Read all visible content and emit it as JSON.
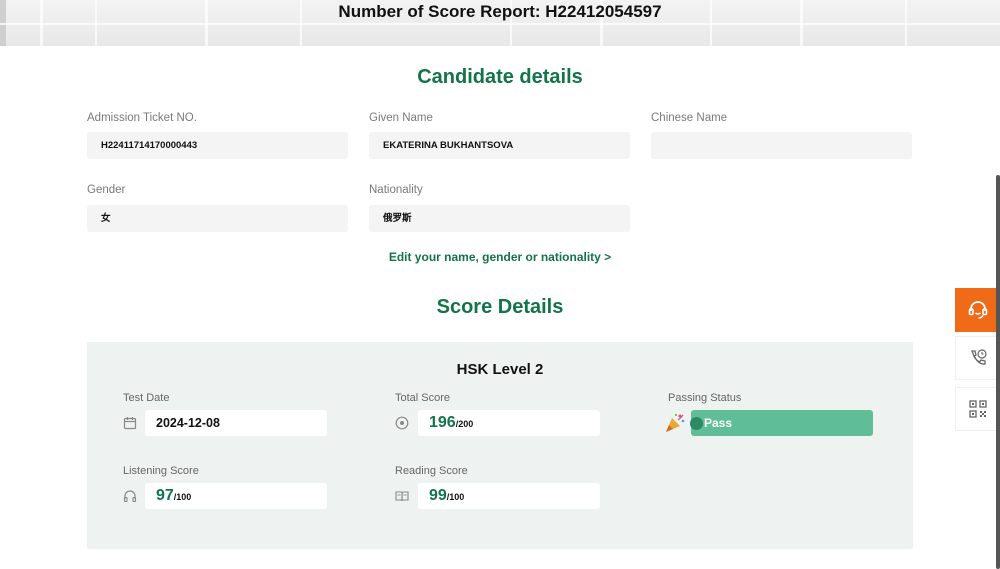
{
  "report": {
    "title": "Number of Score Report: H22412054597"
  },
  "candidate": {
    "section_title": "Candidate details",
    "admission_label": "Admission Ticket NO.",
    "admission_value": "H22411714170000443",
    "given_name_label": "Given Name",
    "given_name_value": "EKATERINA BUKHANTSOVA",
    "chinese_name_label": "Chinese Name",
    "chinese_name_value": "",
    "gender_label": "Gender",
    "gender_value": "女",
    "nationality_label": "Nationality",
    "nationality_value": "俄罗斯",
    "edit_link": "Edit your name, gender or nationality >"
  },
  "score": {
    "section_title": "Score Details",
    "level": "HSK Level 2",
    "test_date_label": "Test Date",
    "test_date_value": "2024-12-08",
    "total_label": "Total Score",
    "total_value": "196",
    "total_max": "/200",
    "passing_label": "Passing Status",
    "passing_value": "Pass",
    "listening_label": "Listening Score",
    "listening_value": "97",
    "listening_max": "/100",
    "reading_label": "Reading Score",
    "reading_value": "99",
    "reading_max": "/100"
  },
  "sidebar": {
    "buttons": [
      {
        "icon": "customer-service-icon",
        "active": true
      },
      {
        "icon": "phone-clock-icon",
        "active": false
      },
      {
        "icon": "qr-code-icon",
        "active": false
      }
    ]
  },
  "colors": {
    "accent": "#13744a",
    "pass": "#5fbe98",
    "orange": "#ef6b18"
  }
}
